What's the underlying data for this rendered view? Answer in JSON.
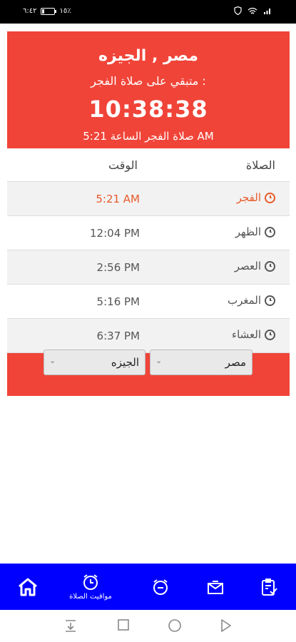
{
  "status_bar": {
    "time": "٦:٤٢",
    "battery": "١٥٪",
    "battery_level": 0.15
  },
  "header": {
    "city_line": "مصر , الجيزه",
    "remaining_label": "متبقي على صلاة الفجر :",
    "countdown": "10:38:38",
    "next_prayer_line": "صلاة الفجر الساعة 5:21 AM"
  },
  "table": {
    "columns": {
      "prayer": "الصلاة",
      "time": "الوقت"
    },
    "rows": [
      {
        "name": "الفجر",
        "time": "5:21 AM"
      },
      {
        "name": "الظهر",
        "time": "12:04 PM"
      },
      {
        "name": "العصر",
        "time": "2:56 PM"
      },
      {
        "name": "المغرب",
        "time": "5:16 PM"
      },
      {
        "name": "العشاء",
        "time": "6:37 PM"
      }
    ]
  },
  "selectors": {
    "country": "مصر",
    "city": "الجيزه"
  },
  "bottom_nav": {
    "prayer_times_label": "مواقيت الصلاة"
  },
  "colors": {
    "card_red": "#f04438",
    "nav_blue": "#0000ff",
    "active_orange": "#e85a2a"
  }
}
